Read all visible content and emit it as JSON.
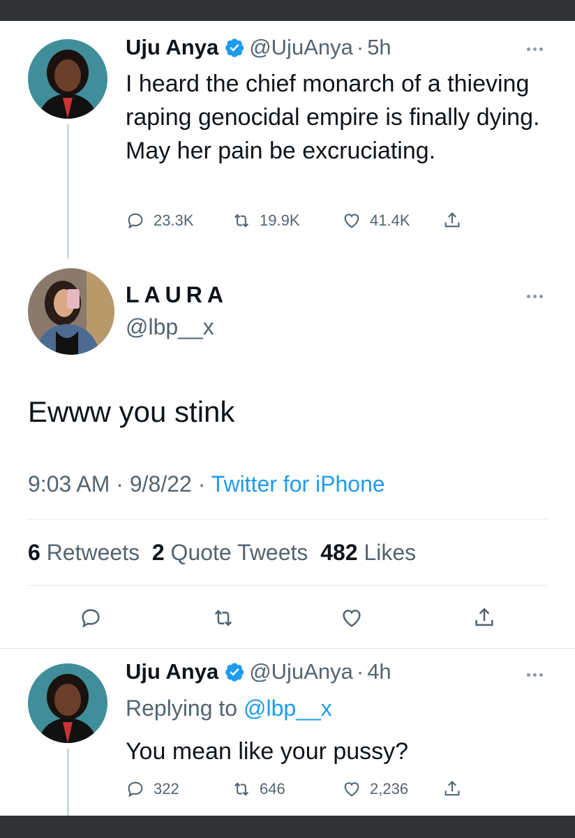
{
  "tweet1": {
    "name": "Uju Anya",
    "handle": "@UjuAnya",
    "time": "5h",
    "text": "I heard the chief monarch of a thieving raping genocidal empire is finally dying. May her pain be excruciating.",
    "reply_count": "23.3K",
    "retweet_count": "19.9K",
    "like_count": "41.4K"
  },
  "main_tweet": {
    "name": "LAURA",
    "handle": "@lbp__x",
    "text": "Ewww you stink",
    "time": "9:03 AM",
    "date": "9/8/22",
    "source": "Twitter for iPhone",
    "retweets": "6",
    "retweets_label": "Retweets",
    "quotes": "2",
    "quotes_label": "Quote Tweets",
    "likes": "482",
    "likes_label": "Likes"
  },
  "tweet2": {
    "name": "Uju Anya",
    "handle": "@UjuAnya",
    "time": "4h",
    "replying_label": "Replying to",
    "replying_handle": "@lbp__x",
    "text": "You mean like your pussy?",
    "reply_count": "322",
    "retweet_count": "646",
    "like_count": "2,236"
  },
  "separator": "·",
  "icons": [
    "verified-badge-icon",
    "more-icon",
    "reply-icon",
    "retweet-icon",
    "like-icon",
    "share-icon"
  ],
  "colors": {
    "accent": "#1d9bf0",
    "text": "#0f1419",
    "muted": "#536471",
    "bar": "#2f3336"
  }
}
